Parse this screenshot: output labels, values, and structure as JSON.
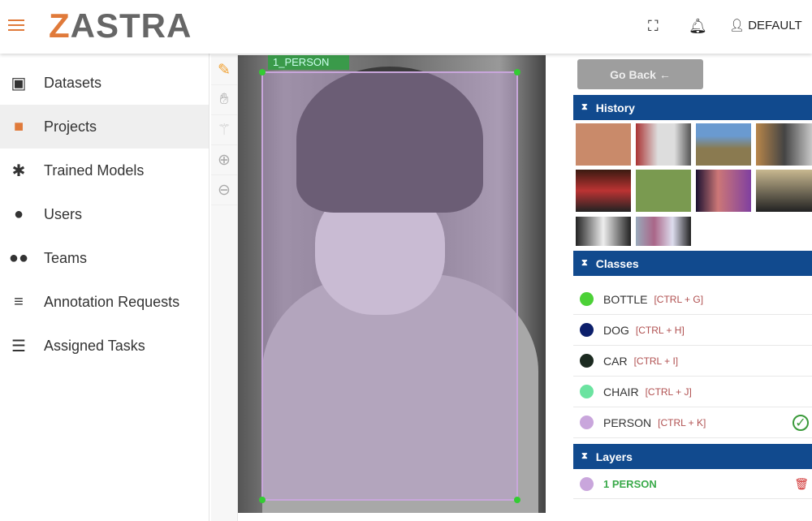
{
  "header": {
    "logo_z": "Z",
    "logo_rest": "ASTRA",
    "user": "DEFAULT"
  },
  "sidebar": {
    "items": [
      {
        "label": "Datasets",
        "icon": "image-stack-icon"
      },
      {
        "label": "Projects",
        "icon": "folder-icon"
      },
      {
        "label": "Trained Models",
        "icon": "puzzle-icon"
      },
      {
        "label": "Users",
        "icon": "person-icon"
      },
      {
        "label": "Teams",
        "icon": "people-icon"
      },
      {
        "label": "Annotation Requests",
        "icon": "list-icon"
      },
      {
        "label": "Assigned Tasks",
        "icon": "list-icon"
      }
    ]
  },
  "canvas": {
    "box_label": "1_PERSON"
  },
  "panel": {
    "go_back": "Go Back ←",
    "history": "History",
    "classes_title": "Classes",
    "layers_title": "Layers",
    "classes": [
      {
        "name": "BOTTLE",
        "shortcut": "[CTRL + G]",
        "color": "#4cd137"
      },
      {
        "name": "DOG",
        "shortcut": "[CTRL + H]",
        "color": "#0c1f6b"
      },
      {
        "name": "CAR",
        "shortcut": "[CTRL + I]",
        "color": "#1b2a20"
      },
      {
        "name": "CHAIR",
        "shortcut": "[CTRL + J]",
        "color": "#6be3a0"
      },
      {
        "name": "PERSON",
        "shortcut": "[CTRL + K]",
        "color": "#c9a6dc"
      }
    ],
    "layers": [
      {
        "name": "1 PERSON",
        "color": "#c9a6dc"
      }
    ]
  },
  "colors": {
    "accent": "#e07a3a",
    "header_blue": "#114a8e"
  }
}
